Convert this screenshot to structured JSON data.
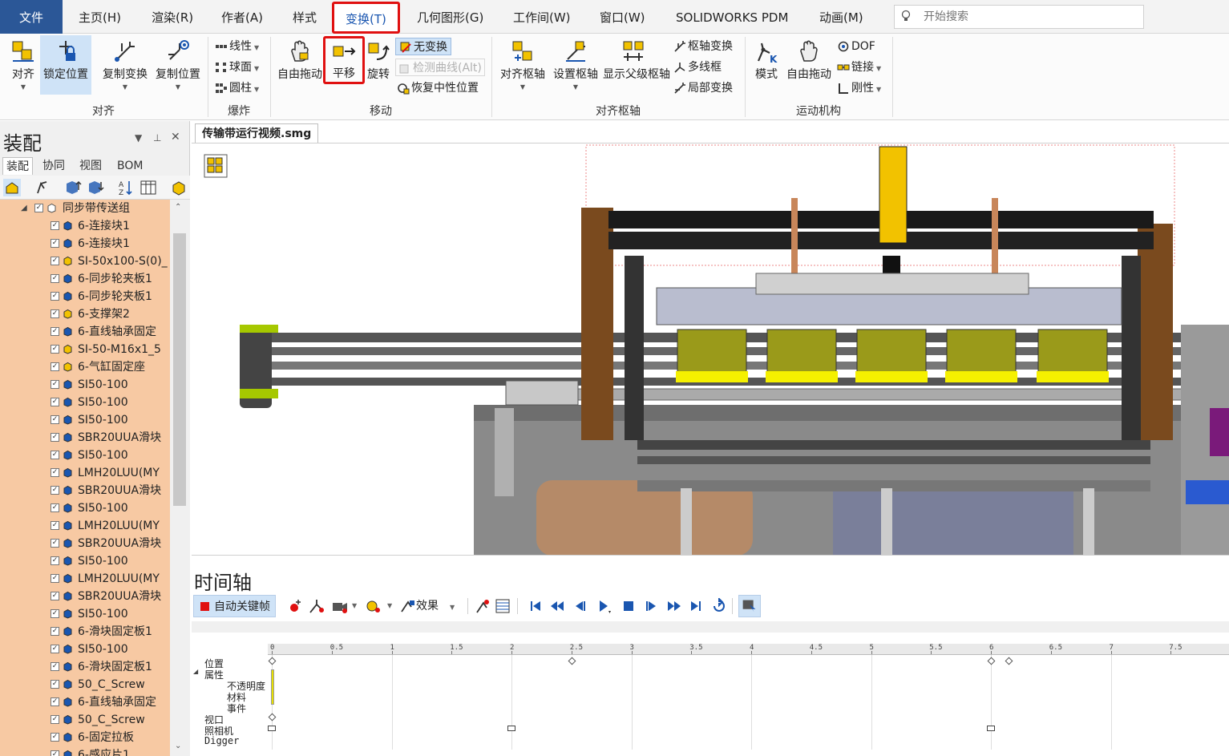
{
  "menu": {
    "file": "文件",
    "home": "主页(H)",
    "render": "渲染(R)",
    "author": "作者(A)",
    "style": "样式",
    "transform": "变换(T)",
    "geometry": "几何图形(G)",
    "workshop": "工作间(W)",
    "window": "窗口(W)",
    "pdm": "SOLIDWORKS PDM",
    "animation": "动画(M)",
    "search_placeholder": "开始搜索"
  },
  "ribbon": {
    "align": "对齐",
    "lock_position": "锁定位置",
    "copy_transform": "复制变换",
    "copy_position": "复制位置",
    "group_align": "对齐",
    "linear": "线性",
    "sphere": "球面",
    "cylinder": "圆柱",
    "group_explode": "爆炸",
    "free_drag": "自由拖动",
    "translate": "平移",
    "rotate": "旋转",
    "no_transform": "无变换",
    "detect_curve": "检测曲线(Alt)",
    "restore_neutral": "恢复中性位置",
    "group_move": "移动",
    "align_pivot": "对齐枢轴",
    "set_pivot": "设置枢轴",
    "show_parent_pivot": "显示父级枢轴",
    "pivot_transform": "枢轴变换",
    "polyline": "多线框",
    "local_transform": "局部变换",
    "group_align_pivot": "对齐枢轴",
    "mode": "模式",
    "free_drag2": "自由拖动",
    "dof": "DOF",
    "link": "链接",
    "rigid": "刚性",
    "group_mechanism": "运动机构"
  },
  "panel": {
    "title": "装配",
    "tabs": [
      "装配",
      "协同",
      "视图",
      "BOM"
    ],
    "tree_root": "同步带传送组",
    "tree_items": [
      {
        "label": "6-连接块1",
        "kind": "part"
      },
      {
        "label": "6-连接块1",
        "kind": "part"
      },
      {
        "label": "SI-50x100-S(0)_",
        "kind": "asm"
      },
      {
        "label": "6-同步轮夹板1",
        "kind": "part"
      },
      {
        "label": "6-同步轮夹板1",
        "kind": "part"
      },
      {
        "label": "6-支撑架2",
        "kind": "asm"
      },
      {
        "label": "6-直线轴承固定",
        "kind": "part"
      },
      {
        "label": "SI-50-M16x1_5",
        "kind": "asm"
      },
      {
        "label": "6-气缸固定座",
        "kind": "asm"
      },
      {
        "label": "SI50-100",
        "kind": "part"
      },
      {
        "label": "SI50-100",
        "kind": "part"
      },
      {
        "label": "SI50-100",
        "kind": "part"
      },
      {
        "label": "SBR20UUA滑块",
        "kind": "part"
      },
      {
        "label": "SI50-100",
        "kind": "part"
      },
      {
        "label": "LMH20LUU(MY",
        "kind": "part"
      },
      {
        "label": "SBR20UUA滑块",
        "kind": "part"
      },
      {
        "label": "SI50-100",
        "kind": "part"
      },
      {
        "label": "LMH20LUU(MY",
        "kind": "part"
      },
      {
        "label": "SBR20UUA滑块",
        "kind": "part"
      },
      {
        "label": "SI50-100",
        "kind": "part"
      },
      {
        "label": "LMH20LUU(MY",
        "kind": "part"
      },
      {
        "label": "SBR20UUA滑块",
        "kind": "part"
      },
      {
        "label": "SI50-100",
        "kind": "part"
      },
      {
        "label": "6-滑块固定板1",
        "kind": "part"
      },
      {
        "label": "SI50-100",
        "kind": "part"
      },
      {
        "label": "6-滑块固定板1",
        "kind": "part"
      },
      {
        "label": "50_C_Screw",
        "kind": "part"
      },
      {
        "label": "6-直线轴承固定",
        "kind": "part"
      },
      {
        "label": "50_C_Screw",
        "kind": "part"
      },
      {
        "label": "6-固定拉板",
        "kind": "part"
      },
      {
        "label": "6-感应片1",
        "kind": "part"
      }
    ]
  },
  "document": {
    "tab_title": "传输带运行视频.smg"
  },
  "timeline": {
    "title": "时间轴",
    "auto_keyframe": "自动关键帧",
    "effects": "效果",
    "ruler_ticks": [
      "0",
      "0.5",
      "1",
      "1.5",
      "2",
      "2.5",
      "3",
      "3.5",
      "4",
      "4.5",
      "5",
      "5.5",
      "6",
      "6.5",
      "7",
      "7.5"
    ],
    "tracks": {
      "position": "位置",
      "property": "属性",
      "opacity": "不透明度",
      "material": "材料",
      "event": "事件",
      "viewport": "视口",
      "camera": "照相机",
      "digger": "Digger"
    },
    "keyframes": {
      "position": [
        0,
        2.5,
        6,
        6.15
      ],
      "viewport": [
        0
      ],
      "camera": [
        0,
        2,
        6
      ]
    }
  },
  "colors": {
    "highlight_red": "#e01010",
    "selected_blue": "#cfe3f7",
    "tree_bg": "#f7c9a3",
    "file_menu": "#2b5797"
  }
}
